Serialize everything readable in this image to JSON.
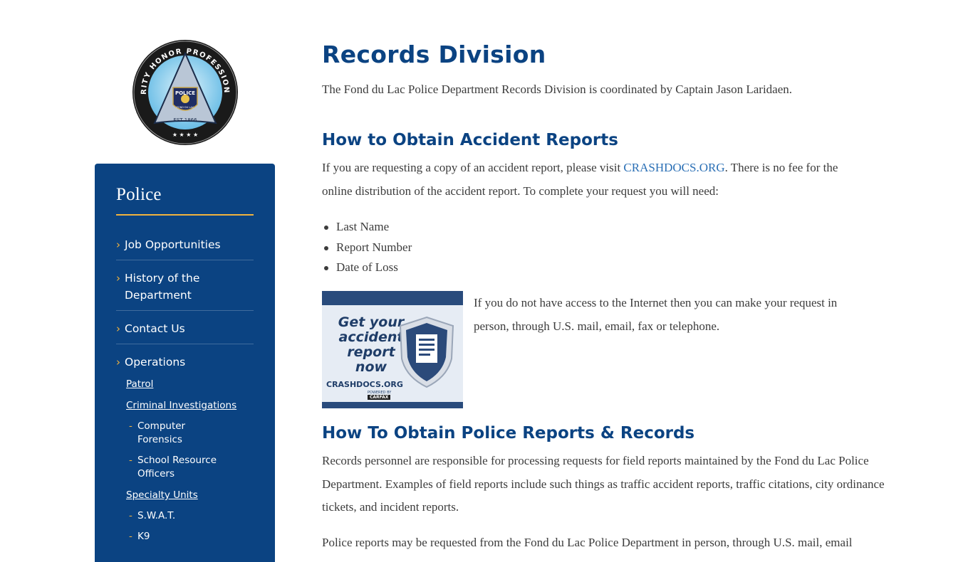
{
  "badge": {
    "arc_text": "INTEGRITY HONOR PROFESSIONALISM",
    "center_text": "POLICE",
    "city_text": "FOND DU LAC",
    "est_text": "EST 1866"
  },
  "sidebar": {
    "title": "Police",
    "items": [
      {
        "label": "Job Opportunities"
      },
      {
        "label": "History of the Department"
      },
      {
        "label": "Contact Us"
      },
      {
        "label": "Operations"
      }
    ],
    "operations_sub": [
      {
        "label": "Patrol"
      },
      {
        "label": "Criminal Investigations"
      },
      {
        "label": "Computer Forensics"
      },
      {
        "label": "School Resource Officers"
      },
      {
        "label": "Specialty Units"
      },
      {
        "label": "S.W.A.T."
      },
      {
        "label": "K9"
      }
    ]
  },
  "main": {
    "title": "Records Division",
    "intro": "The Fond du Lac Police Department Records Division is coordinated by Captain Jason Laridaen.",
    "accident": {
      "heading": "How to Obtain Accident Reports",
      "para_before": "If you are requesting a copy of an accident report, please visit ",
      "link": "CRASHDOCS.ORG",
      "para_after": ". There is no fee for the online distribution of the accident report.  To complete your request you will need:",
      "bullets": [
        "Last Name",
        "Report Number",
        "Date of Loss"
      ],
      "banner": {
        "line": "Get your accident report now",
        "site": "CRASHDOCS.ORG",
        "powered": "POWERED BY",
        "brand": "CARFAX"
      },
      "offline": "If you do not have access to the Internet then you can make your request in person, through U.S. mail, email, fax or telephone."
    },
    "police": {
      "heading": "How To Obtain Police Reports & Records",
      "para1": "Records personnel are responsible for processing requests for field reports maintained by the Fond du Lac Police Department. Examples of field reports include such things as traffic accident reports, traffic citations, city ordinance tickets, and incident reports.",
      "para2": "Police reports may be requested from the Fond du Lac Police Department in person, through U.S. mail, email"
    }
  },
  "colors": {
    "brand_blue": "#0b4382",
    "accent_gold": "#f2b33d",
    "link_blue": "#2a6fb5"
  }
}
